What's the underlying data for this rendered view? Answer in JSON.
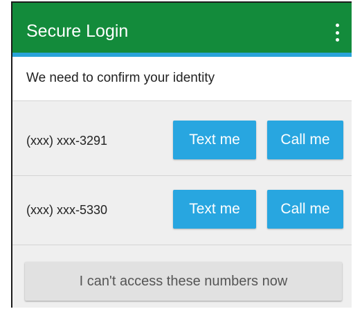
{
  "app_bar": {
    "title": "Secure Login",
    "menu_icon": "overflow-menu-icon",
    "color": "#138b3b",
    "accent_line_color": "#29a3d9"
  },
  "subheader": {
    "text": "We need to confirm your identity"
  },
  "phones": [
    {
      "number": "(xxx) xxx-3291",
      "text_label": "Text me",
      "call_label": "Call me"
    },
    {
      "number": "(xxx) xxx-5330",
      "text_label": "Text me",
      "call_label": "Call me"
    }
  ],
  "footer": {
    "label": "I can't access these numbers now"
  },
  "colors": {
    "button": "#28a6e0",
    "background": "#efefef"
  }
}
